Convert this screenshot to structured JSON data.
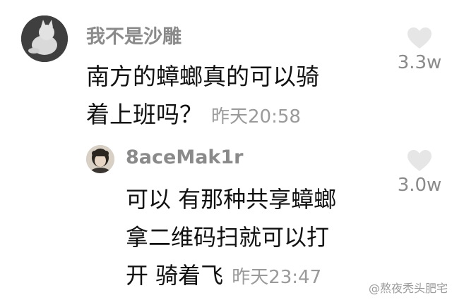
{
  "comments": [
    {
      "username": "我不是沙雕",
      "lines": [
        "南方的蟑螂真的可以骑",
        "着上班吗？"
      ],
      "time": "昨天20:58",
      "likes": "3.3w",
      "avatar_icon": "cat-avatar-icon",
      "like_icon": "heart-icon"
    },
    {
      "username": "8aceMak1r",
      "lines": [
        "可以 有那种共享蟑螂",
        "拿二维码扫就可以打",
        "开 骑着飞"
      ],
      "time": "昨天23:47",
      "likes": "3.0w",
      "avatar_icon": "person-avatar-icon",
      "like_icon": "heart-icon"
    }
  ],
  "watermark": "@熬夜秃头肥宅",
  "colors": {
    "username": "#8a8a8a",
    "time": "#9a9a9a",
    "heart": "#e6e6e6",
    "text": "#111111"
  }
}
